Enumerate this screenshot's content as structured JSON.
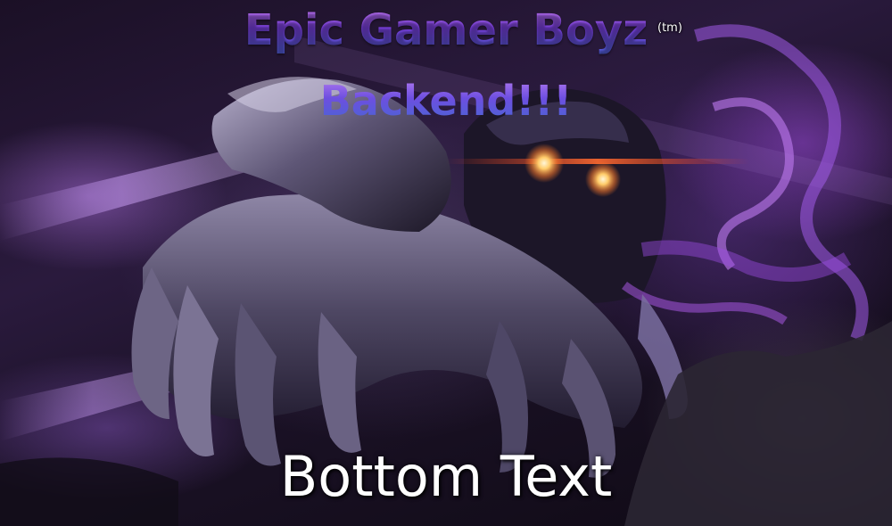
{
  "meme": {
    "title_line_1": "Epic Gamer Boyz",
    "trademark": "(tm)",
    "title_line_2": "Backend!!!",
    "bottom_text": "Bottom Text"
  },
  "image": {
    "subject_icon": "armored-purple-creature-art",
    "glowing_eyes_color": "#ffd27a",
    "accent_color": "#8a4be0",
    "background_color": "#1b1026"
  }
}
